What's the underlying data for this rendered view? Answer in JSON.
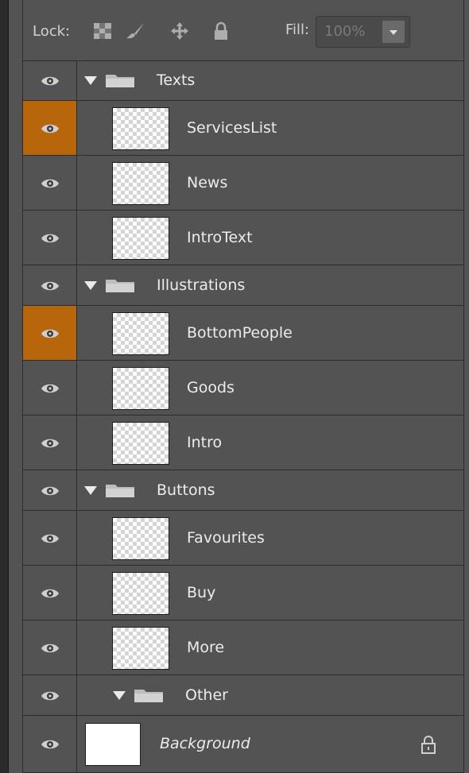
{
  "lock_bar": {
    "lock_label": "Lock:",
    "icons": [
      "lock-transparent-pixels-icon",
      "lock-image-pixels-icon",
      "lock-position-icon",
      "lock-all-icon"
    ],
    "fill_label": "Fill:",
    "fill_value": "100%"
  },
  "layers": [
    {
      "name": "Texts",
      "kind": "group",
      "visible": true,
      "highlighted": false
    },
    {
      "name": "ServicesList",
      "kind": "layer",
      "visible": true,
      "highlighted": true
    },
    {
      "name": "News",
      "kind": "layer",
      "visible": true,
      "highlighted": false
    },
    {
      "name": "IntroText",
      "kind": "layer",
      "visible": true,
      "highlighted": false
    },
    {
      "name": "Illustrations",
      "kind": "group",
      "visible": true,
      "highlighted": false
    },
    {
      "name": "BottomPeople",
      "kind": "layer",
      "visible": true,
      "highlighted": true
    },
    {
      "name": "Goods",
      "kind": "layer",
      "visible": true,
      "highlighted": false
    },
    {
      "name": "Intro",
      "kind": "layer",
      "visible": true,
      "highlighted": false
    },
    {
      "name": "Buttons",
      "kind": "group",
      "visible": true,
      "highlighted": false
    },
    {
      "name": "Favourites",
      "kind": "layer",
      "visible": true,
      "highlighted": false
    },
    {
      "name": "Buy",
      "kind": "layer",
      "visible": true,
      "highlighted": false
    },
    {
      "name": "More",
      "kind": "layer",
      "visible": true,
      "highlighted": false
    },
    {
      "name": "Other",
      "kind": "group",
      "visible": true,
      "highlighted": false
    },
    {
      "name": "Background",
      "kind": "background",
      "visible": true,
      "highlighted": false,
      "locked": true
    }
  ],
  "colors": {
    "panel_bg": "#535353",
    "highlight": "#b8660b",
    "divider": "#2c2c2c"
  }
}
